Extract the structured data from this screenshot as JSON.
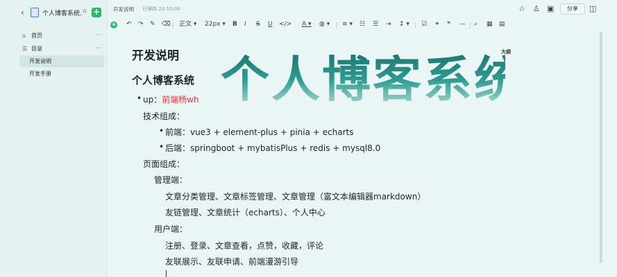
{
  "sidebar": {
    "back_icon": "chevron-left-icon",
    "title": "个人博客系统...",
    "add_label": "+",
    "items": [
      {
        "icon": "home-icon",
        "label": "首页",
        "more": "⋯"
      },
      {
        "icon": "list-icon",
        "label": "目录",
        "more": "⋯"
      }
    ],
    "children": [
      {
        "label": "开发说明",
        "active": true
      },
      {
        "label": "开发手册",
        "active": false
      }
    ]
  },
  "topbar": {
    "breadcrumb": "开发说明",
    "saved_status": "已保存 23:10:00",
    "share_label": "分享"
  },
  "toolbar": {
    "paragraph_style": "正文",
    "font_size": "22px",
    "bold": "B",
    "italic": "I",
    "strike": "S",
    "underline": "U",
    "font_color": "A",
    "highlight": "A"
  },
  "doc": {
    "outline_label": "大纲",
    "title": "开发说明",
    "heading": "个人博客系统",
    "banner_text": "个人博客系统",
    "up_prefix": "up：",
    "up_name": "前端杨wh",
    "tech_label": "技术组成：",
    "frontend": "前端：vue3 + element-plus + pinia + echarts",
    "backend": "后端：springboot + mybatisPlus + redis + mysql8.0",
    "page_label": "页面组成：",
    "admin_label": "管理端：",
    "admin_line1": "文章分类管理、文章标签管理、文章管理（富文本编辑器markdown）",
    "admin_line2": "友链管理、文章统计（echarts）、个人中心",
    "user_label": "用户端：",
    "user_line1": "注册、登录、文章查看，点赞，收藏，评论",
    "user_line2": "友联展示、友联申请、前端漫游引导"
  },
  "colors": {
    "accent_green": "#2bb673",
    "link_red": "#d33a3a",
    "banner_teal": "#2f8a84",
    "background": "#eaf6f5"
  }
}
